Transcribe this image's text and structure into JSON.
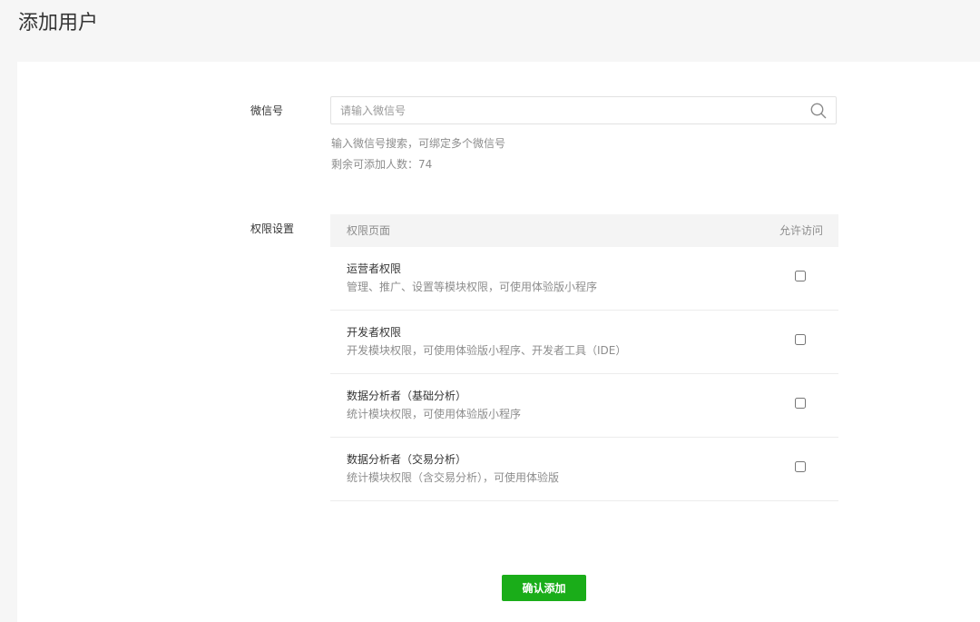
{
  "page": {
    "title": "添加用户"
  },
  "wechat": {
    "label": "微信号",
    "placeholder": "请输入微信号",
    "value": "",
    "hint": "输入微信号搜索，可绑定多个微信号",
    "remaining": "剩余可添加人数：74"
  },
  "permissions": {
    "label": "权限设置",
    "header": {
      "page": "权限页面",
      "allow": "允许访问"
    },
    "rows": [
      {
        "title": "运营者权限",
        "desc": "管理、推广、设置等模块权限，可使用体验版小程序",
        "checked": false
      },
      {
        "title": "开发者权限",
        "desc": "开发模块权限，可使用体验版小程序、开发者工具（IDE）",
        "checked": false
      },
      {
        "title": "数据分析者（基础分析）",
        "desc": "统计模块权限，可使用体验版小程序",
        "checked": false
      },
      {
        "title": "数据分析者（交易分析）",
        "desc": "统计模块权限（含交易分析），可使用体验版",
        "checked": false
      }
    ]
  },
  "actions": {
    "confirm_label": "确认添加"
  },
  "colors": {
    "accent": "#1aad19",
    "background": "#f6f6f6",
    "panel": "#ffffff"
  },
  "icons": {
    "search": "search-icon"
  }
}
